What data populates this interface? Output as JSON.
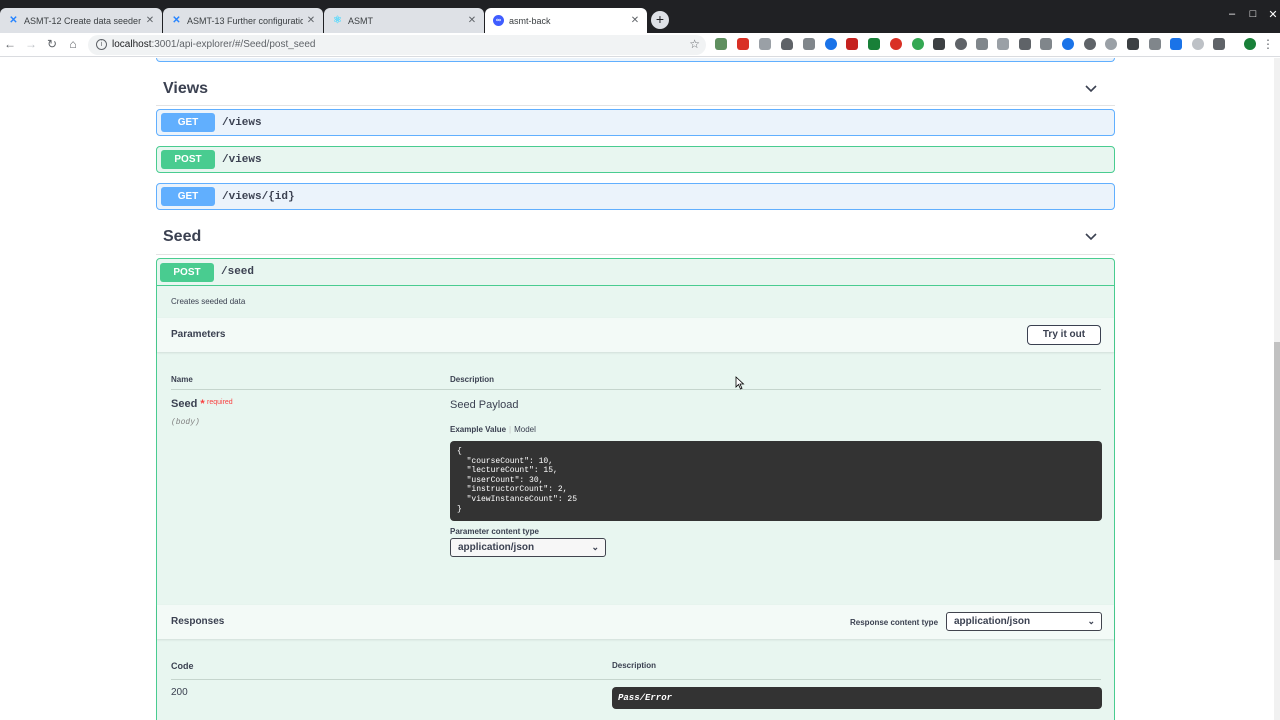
{
  "browser": {
    "tabs": [
      {
        "title": "ASMT-12 Create data seeder - ",
        "icon": "confluence-icon",
        "active": false
      },
      {
        "title": "ASMT-13 Further configuratio",
        "icon": "confluence-icon",
        "active": false
      },
      {
        "title": "ASMT",
        "icon": "react-icon",
        "active": false
      },
      {
        "title": "asmt-back",
        "icon": "loopback-icon",
        "active": true
      }
    ],
    "new_tab": "+",
    "window_controls": {
      "minimize": "–",
      "maximize": "□",
      "close": "✕"
    },
    "url_host": "localhost",
    "url_rest": ":3001/api-explorer/#/Seed/post_seed"
  },
  "sections": {
    "views": {
      "title": "Views",
      "operations": [
        {
          "method": "GET",
          "path": "/views"
        },
        {
          "method": "POST",
          "path": "/views"
        },
        {
          "method": "GET",
          "path": "/views/{id}"
        }
      ]
    },
    "seed": {
      "title": "Seed",
      "operation": {
        "method": "POST",
        "path": "/seed",
        "description": "Creates seeded data",
        "parameters_title": "Parameters",
        "try_it_out": "Try it out",
        "col_name": "Name",
        "col_description": "Description",
        "param_name": "Seed",
        "param_required_star": "*",
        "param_required": "required",
        "param_in": "(body)",
        "param_description": "Seed Payload",
        "example_value_tab": "Example Value",
        "model_tab": "Model",
        "example_json": "{\n  \"courseCount\": 10,\n  \"lectureCount\": 15,\n  \"userCount\": 30,\n  \"instructorCount\": 2,\n  \"viewInstanceCount\": 25\n}",
        "param_content_type_label": "Parameter content type",
        "param_content_type": "application/json",
        "responses_title": "Responses",
        "response_content_type_label": "Response content type",
        "response_content_type": "application/json",
        "col_code": "Code",
        "col_resp_description": "Description",
        "response_code": "200",
        "response_schema": "Pass/Error"
      }
    }
  }
}
